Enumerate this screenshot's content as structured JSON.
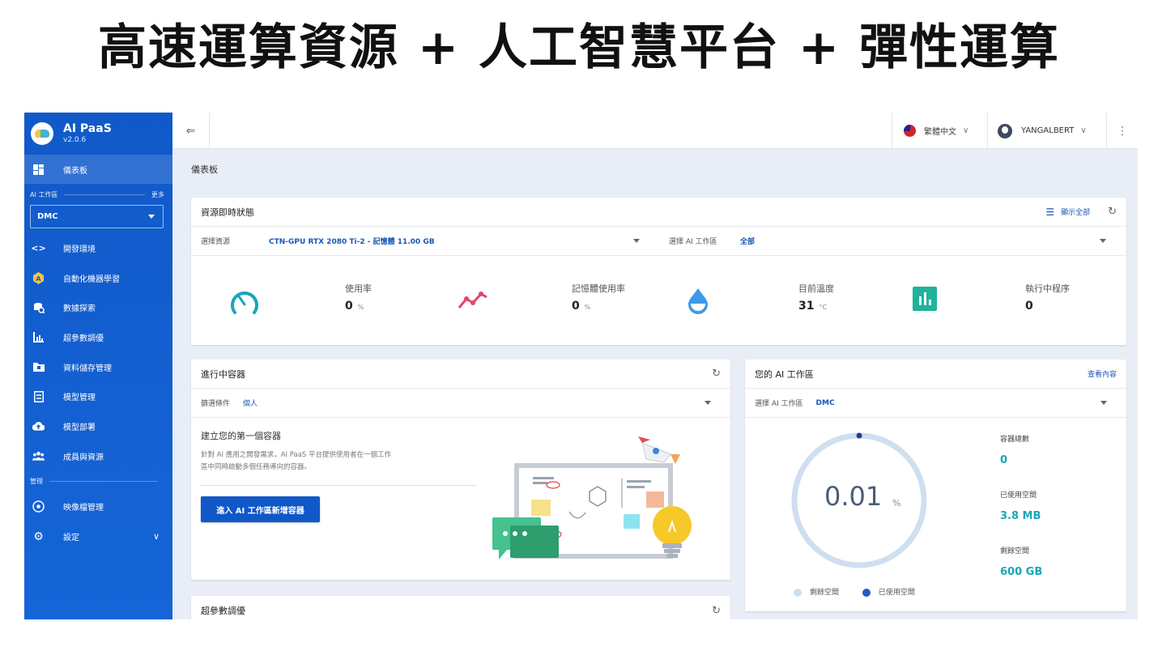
{
  "banner": {
    "title": "高速運算資源 + 人工智慧平台 + 彈性運算"
  },
  "sidebar": {
    "brand_title": "AI PaaS",
    "brand_version": "v2.0.6",
    "dashboard_label": "儀表板",
    "workspace_section": "AI 工作區",
    "workspace_more": "更多",
    "workspace_selected": "DMC",
    "items": [
      {
        "label": "開發環境",
        "icon": "code-icon"
      },
      {
        "label": "自動化機器學習",
        "icon": "automl-icon"
      },
      {
        "label": "數據探索",
        "icon": "data-search-icon"
      },
      {
        "label": "超參數調優",
        "icon": "chart-icon"
      },
      {
        "label": "資料儲存管理",
        "icon": "folder-icon"
      },
      {
        "label": "模型管理",
        "icon": "model-icon"
      },
      {
        "label": "模型部署",
        "icon": "cloud-upload-icon"
      },
      {
        "label": "成員與資源",
        "icon": "people-icon"
      }
    ],
    "manage_section": "管理",
    "manage_items": [
      {
        "label": "映像檔管理",
        "icon": "image-icon"
      },
      {
        "label": "設定",
        "icon": "gear-icon"
      }
    ]
  },
  "topbar": {
    "language": "繁體中文",
    "username": "YANGALBERT"
  },
  "breadcrumb": "儀表板",
  "resource_card": {
    "title": "資源即時狀態",
    "show_all": "顯示全部",
    "filter_resource_label": "選擇資源",
    "filter_resource_value": "CTN-GPU RTX 2080 Ti-2 - 記憶體 11.00 GB",
    "filter_ws_label": "選擇 AI 工作區",
    "filter_ws_value": "全部",
    "metrics": [
      {
        "label": "使用率",
        "value": "0",
        "unit": "%",
        "icon": "gauge-icon",
        "color": "#17a6b8"
      },
      {
        "label": "記憶體使用率",
        "value": "0",
        "unit": "%",
        "icon": "trend-icon",
        "color": "#e2456b"
      },
      {
        "label": "目前溫度",
        "value": "31",
        "unit": "°C",
        "icon": "drop-icon",
        "color": "#3d9ae8"
      },
      {
        "label": "執行中程序",
        "value": "0",
        "unit": "",
        "icon": "bar-chart-icon",
        "color": "#20b39a"
      }
    ]
  },
  "containers_card": {
    "title": "進行中容器",
    "filter_label": "篩選條件",
    "filter_value": "個人",
    "empty_title": "建立您的第一個容器",
    "empty_desc_1": "針對 AI 應用之開發需求，AI PaaS 平台提供使用者在一個工作",
    "empty_desc_2": "區中同時啟動多個任務導向的容器。",
    "cta": "進入 AI 工作區新增容器"
  },
  "workspace_card": {
    "title": "您的 AI 工作區",
    "view": "查看內容",
    "filter_label": "選擇 AI 工作區",
    "filter_value": "DMC",
    "usage_value": "0.01",
    "usage_unit": "%",
    "usage_fraction": 0.0001,
    "stats": [
      {
        "label": "容器總數",
        "value": "0"
      },
      {
        "label": "已使用空間",
        "value": "3.8 MB"
      },
      {
        "label": "剩餘空間",
        "value": "600 GB"
      }
    ],
    "legend_free": "剩餘空間",
    "legend_used": "已使用空間"
  },
  "hyper_card": {
    "title": "超參數調優"
  },
  "colors": {
    "primary": "#1058c8",
    "sidebar": "#1159c9",
    "teal": "#1aa6b8"
  }
}
